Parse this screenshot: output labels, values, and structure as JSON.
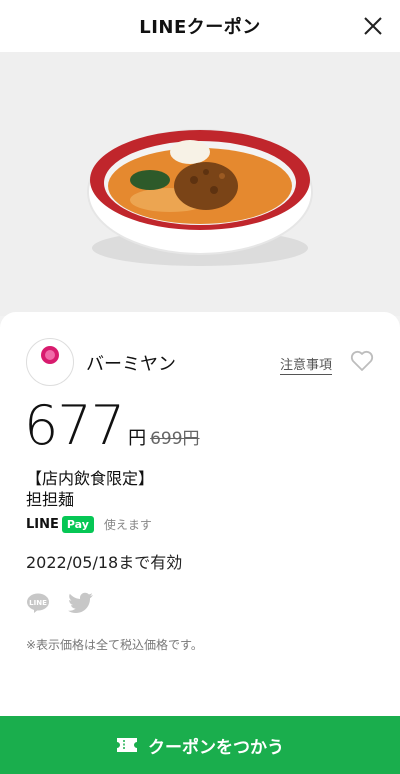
{
  "header": {
    "title": "LINEクーポン",
    "close_icon": "close-icon"
  },
  "hero": {
    "alt": "担担麺"
  },
  "shop": {
    "name": "バーミヤン",
    "logo_text": "バーミヤン",
    "notes_label": "注意事項",
    "favorite_icon": "heart-outline-icon"
  },
  "price": {
    "current": "677",
    "unit": "円",
    "original": "699円"
  },
  "item": {
    "limit_tag": "【店内飲食限定】",
    "name": "担担麺"
  },
  "payment": {
    "brand": "LINE",
    "pay_badge": "Pay",
    "status": "使えます"
  },
  "expiry": "2022/05/18まで有効",
  "share": {
    "line_icon": "line-share-icon",
    "twitter_icon": "twitter-icon"
  },
  "disclaimer": "※表示価格は全て税込価格です。",
  "cta": {
    "label": "クーポンをつかう",
    "icon": "ticket-icon"
  },
  "colors": {
    "accent": "#1aae4d",
    "line_pay": "#06c755"
  }
}
